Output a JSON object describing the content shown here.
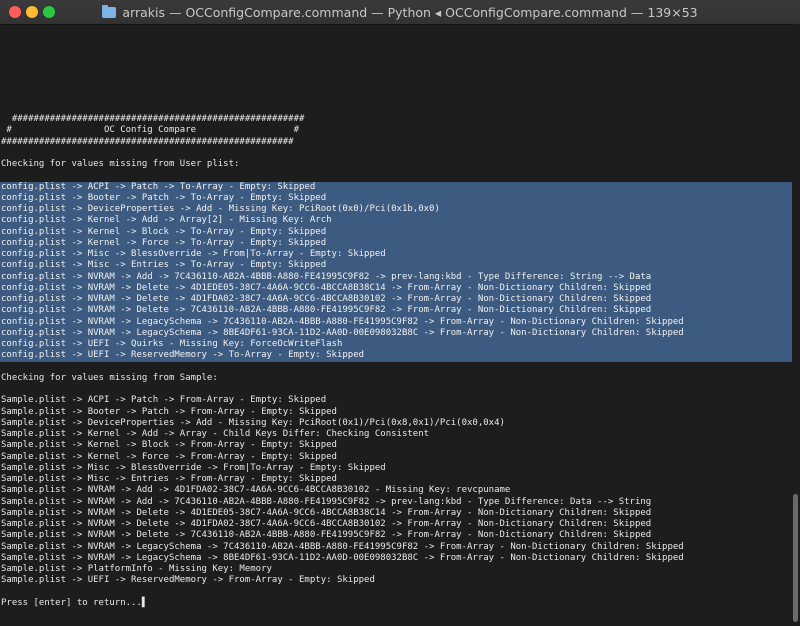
{
  "window": {
    "title": "arrakis — OCConfigCompare.command — Python ◂ OCConfigCompare.command — 139×53",
    "buttons": {
      "close": "close",
      "minimize": "minimize",
      "zoom": "zoom"
    },
    "colors": {
      "close": "#ff5f57",
      "minimize": "#febc2e",
      "zoom": "#28c840",
      "selection": "#3d5b80",
      "background": "#1d1d1d"
    }
  },
  "terminal": {
    "lines": [
      {
        "text": "",
        "sel": false
      },
      {
        "text": "",
        "sel": false
      },
      {
        "text": "",
        "sel": false
      },
      {
        "text": "",
        "sel": false
      },
      {
        "text": "",
        "sel": false
      },
      {
        "text": "",
        "sel": false
      },
      {
        "text": "",
        "sel": false
      },
      {
        "text": "",
        "sel": false
      },
      {
        "text": "  ######################################################",
        "sel": false
      },
      {
        "text": " #                 OC Config Compare                  #",
        "sel": false
      },
      {
        "text": "######################################################",
        "sel": false
      },
      {
        "text": "",
        "sel": false
      },
      {
        "text": "Checking for values missing from User plist:",
        "sel": false
      },
      {
        "text": "",
        "sel": false
      },
      {
        "text": "config.plist -> ACPI -> Patch -> To-Array - Empty: Skipped",
        "sel": true
      },
      {
        "text": "config.plist -> Booter -> Patch -> To-Array - Empty: Skipped",
        "sel": true
      },
      {
        "text": "config.plist -> DeviceProperties -> Add - Missing Key: PciRoot(0x0)/Pci(0x1b,0x0)",
        "sel": true
      },
      {
        "text": "config.plist -> Kernel -> Add -> Array[2] - Missing Key: Arch",
        "sel": true
      },
      {
        "text": "config.plist -> Kernel -> Block -> To-Array - Empty: Skipped",
        "sel": true
      },
      {
        "text": "config.plist -> Kernel -> Force -> To-Array - Empty: Skipped",
        "sel": true
      },
      {
        "text": "config.plist -> Misc -> BlessOverride -> From|To-Array - Empty: Skipped",
        "sel": true
      },
      {
        "text": "config.plist -> Misc -> Entries -> To-Array - Empty: Skipped",
        "sel": true
      },
      {
        "text": "config.plist -> NVRAM -> Add -> 7C436110-AB2A-4BBB-A880-FE41995C9F82 -> prev-lang:kbd - Type Difference: String --> Data",
        "sel": true
      },
      {
        "text": "config.plist -> NVRAM -> Delete -> 4D1EDE05-38C7-4A6A-9CC6-4BCCA8B38C14 -> From-Array - Non-Dictionary Children: Skipped",
        "sel": true
      },
      {
        "text": "config.plist -> NVRAM -> Delete -> 4D1FDA02-38C7-4A6A-9CC6-4BCCA8B30102 -> From-Array - Non-Dictionary Children: Skipped",
        "sel": true
      },
      {
        "text": "config.plist -> NVRAM -> Delete -> 7C436110-AB2A-4BBB-A880-FE41995C9F82 -> From-Array - Non-Dictionary Children: Skipped",
        "sel": true
      },
      {
        "text": "config.plist -> NVRAM -> LegacySchema -> 7C436110-AB2A-4BBB-A880-FE41995C9F82 -> From-Array - Non-Dictionary Children: Skipped",
        "sel": true
      },
      {
        "text": "config.plist -> NVRAM -> LegacySchema -> 8BE4DF61-93CA-11D2-AA0D-00E098032B8C -> From-Array - Non-Dictionary Children: Skipped",
        "sel": true
      },
      {
        "text": "config.plist -> UEFI -> Quirks - Missing Key: ForceOcWriteFlash",
        "sel": true
      },
      {
        "text": "config.plist -> UEFI -> ReservedMemory -> To-Array - Empty: Skipped",
        "sel": true
      },
      {
        "text": "",
        "sel": false
      },
      {
        "text": "Checking for values missing from Sample:",
        "sel": false
      },
      {
        "text": "",
        "sel": false
      },
      {
        "text": "Sample.plist -> ACPI -> Patch -> From-Array - Empty: Skipped",
        "sel": false
      },
      {
        "text": "Sample.plist -> Booter -> Patch -> From-Array - Empty: Skipped",
        "sel": false
      },
      {
        "text": "Sample.plist -> DeviceProperties -> Add - Missing Key: PciRoot(0x1)/Pci(0x8,0x1)/Pci(0x0,0x4)",
        "sel": false
      },
      {
        "text": "Sample.plist -> Kernel -> Add -> Array - Child Keys Differ: Checking Consistent",
        "sel": false
      },
      {
        "text": "Sample.plist -> Kernel -> Block -> From-Array - Empty: Skipped",
        "sel": false
      },
      {
        "text": "Sample.plist -> Kernel -> Force -> From-Array - Empty: Skipped",
        "sel": false
      },
      {
        "text": "Sample.plist -> Misc -> BlessOverride -> From|To-Array - Empty: Skipped",
        "sel": false
      },
      {
        "text": "Sample.plist -> Misc -> Entries -> From-Array - Empty: Skipped",
        "sel": false
      },
      {
        "text": "Sample.plist -> NVRAM -> Add -> 4D1FDA02-38C7-4A6A-9CC6-4BCCA8B30102 - Missing Key: revcpuname",
        "sel": false
      },
      {
        "text": "Sample.plist -> NVRAM -> Add -> 7C436110-AB2A-4BBB-A880-FE41995C9F82 -> prev-lang:kbd - Type Difference: Data --> String",
        "sel": false
      },
      {
        "text": "Sample.plist -> NVRAM -> Delete -> 4D1EDE05-38C7-4A6A-9CC6-4BCCA8B38C14 -> From-Array - Non-Dictionary Children: Skipped",
        "sel": false
      },
      {
        "text": "Sample.plist -> NVRAM -> Delete -> 4D1FDA02-38C7-4A6A-9CC6-4BCCA8B30102 -> From-Array - Non-Dictionary Children: Skipped",
        "sel": false
      },
      {
        "text": "Sample.plist -> NVRAM -> Delete -> 7C436110-AB2A-4BBB-A880-FE41995C9F82 -> From-Array - Non-Dictionary Children: Skipped",
        "sel": false
      },
      {
        "text": "Sample.plist -> NVRAM -> LegacySchema -> 7C436110-AB2A-4BBB-A880-FE41995C9F82 -> From-Array - Non-Dictionary Children: Skipped",
        "sel": false
      },
      {
        "text": "Sample.plist -> NVRAM -> LegacySchema -> 8BE4DF61-93CA-11D2-AA0D-00E098032B8C -> From-Array - Non-Dictionary Children: Skipped",
        "sel": false
      },
      {
        "text": "Sample.plist -> PlatformInfo - Missing Key: Memory",
        "sel": false
      },
      {
        "text": "Sample.plist -> UEFI -> ReservedMemory -> From-Array - Empty: Skipped",
        "sel": false
      },
      {
        "text": "",
        "sel": false
      },
      {
        "text": "Press [enter] to return...▌",
        "sel": false
      }
    ]
  }
}
